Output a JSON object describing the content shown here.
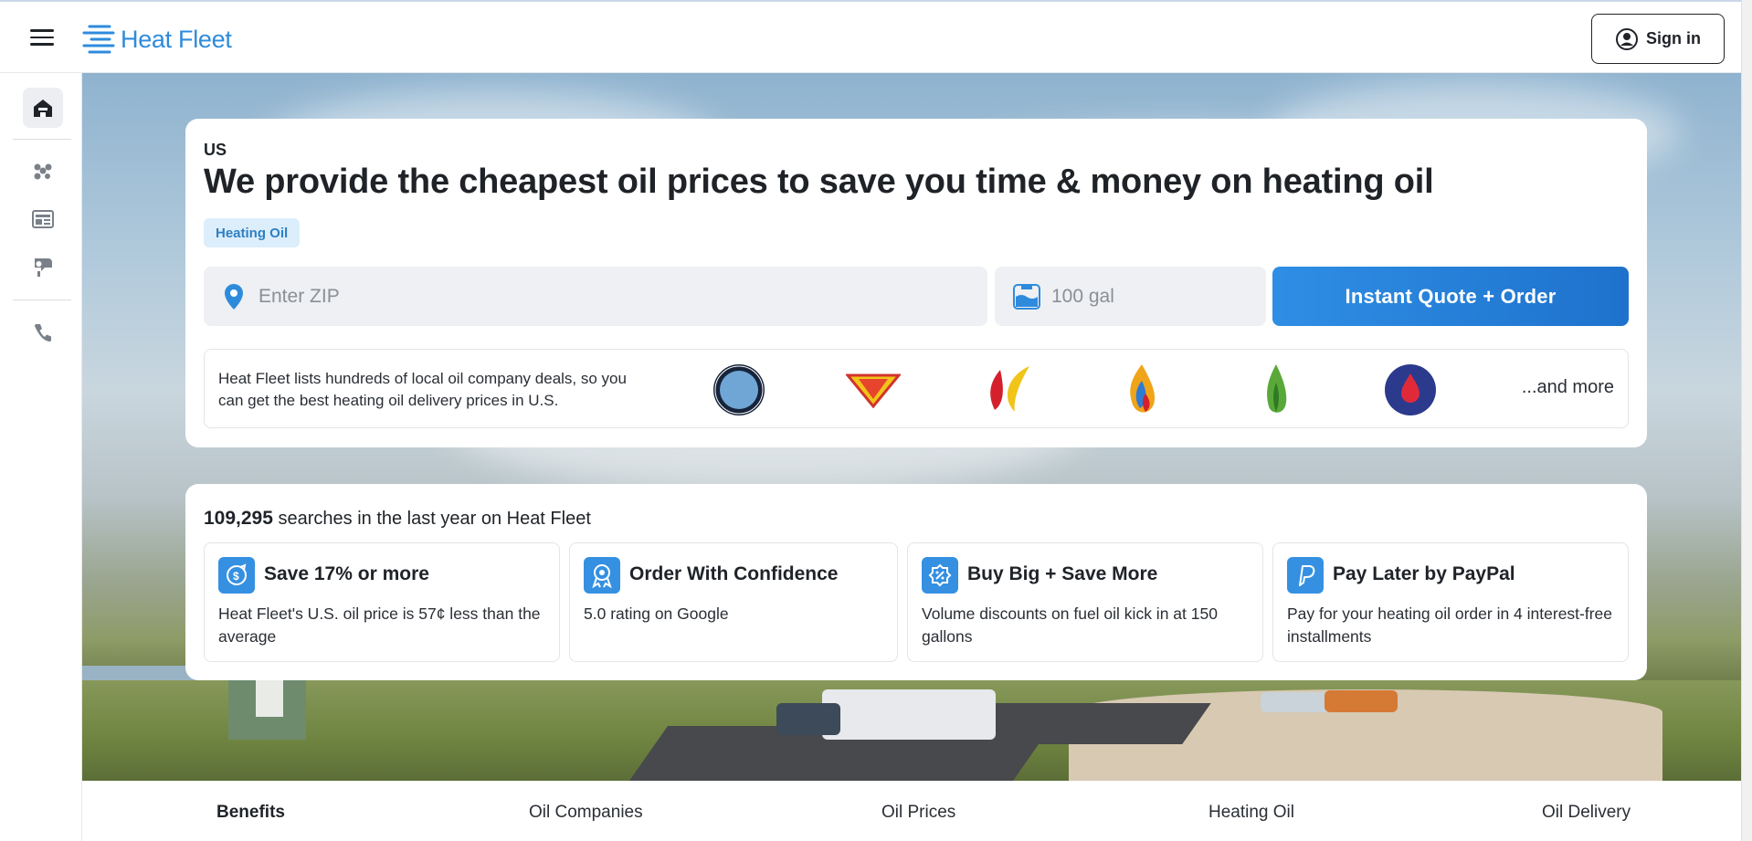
{
  "header": {
    "brand": "Heat Fleet",
    "signin_label": "Sign in",
    "menu_icon": "hamburger-menu-icon"
  },
  "rail": {
    "items": [
      {
        "icon": "home-icon",
        "active": true
      },
      {
        "icon": "companies-icon",
        "active": false
      },
      {
        "icon": "prices-icon",
        "active": false
      },
      {
        "icon": "learn-icon",
        "active": false
      },
      {
        "icon": "phone-icon",
        "active": false
      }
    ]
  },
  "hero": {
    "country": "US",
    "headline": "We provide the cheapest oil prices to save you time & money on heating oil",
    "chip": "Heating Oil",
    "zip_placeholder": "Enter ZIP",
    "gallons_placeholder": "100 gal",
    "cta_label": "Instant Quote + Order",
    "logos_text": "Heat Fleet lists hundreds of local oil company deals, so you can get the best heating oil delivery prices in U.S.",
    "brand_logos": [
      "Peterson",
      "AL'S",
      "red-yellow-flame",
      "multicolor-flame",
      "green-flame",
      "blue-drop"
    ],
    "and_more": "...and more"
  },
  "stats": {
    "count": "109,295",
    "suffix": "searches in the last year on Heat Fleet",
    "features": [
      {
        "title": "Save 17% or more",
        "desc": "Heat Fleet's U.S. oil price is 57¢ less than the average",
        "icon": "savings-icon"
      },
      {
        "title": "Order With Confidence",
        "desc": "5.0 rating on Google",
        "icon": "award-icon"
      },
      {
        "title": "Buy Big + Save More",
        "desc": "Volume discounts on fuel oil kick in at 150 gallons",
        "icon": "discount-badge-icon"
      },
      {
        "title": "Pay Later by PayPal",
        "desc": "Pay for your heating oil order in 4 interest-free installments",
        "icon": "paypal-icon"
      }
    ]
  },
  "tabs": [
    {
      "label": "Benefits",
      "active": true
    },
    {
      "label": "Oil Companies",
      "active": false
    },
    {
      "label": "Oil Prices",
      "active": false
    },
    {
      "label": "Heating Oil",
      "active": false
    },
    {
      "label": "Oil Delivery",
      "active": false
    }
  ],
  "colors": {
    "brand": "#2e8bdc",
    "cta": "#1e72cc",
    "chip_bg": "#dceefb"
  }
}
